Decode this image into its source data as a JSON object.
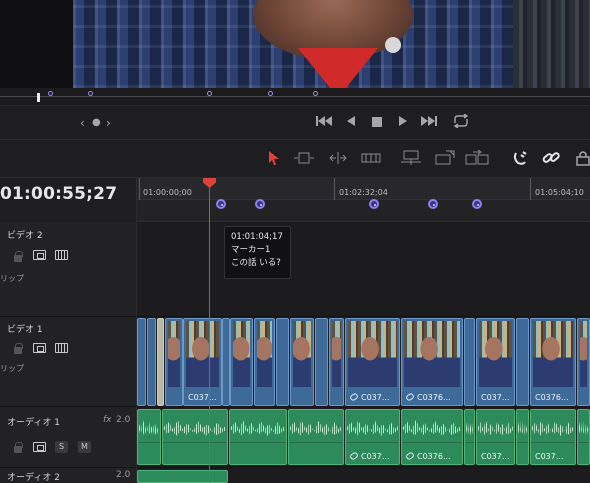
{
  "viewer": {
    "jog_markers": 5
  },
  "ruler": {
    "timecode": "01:00:55;27",
    "ticks": [
      "01:00:00;00",
      "01:02:32;04",
      "01:05:04;10"
    ]
  },
  "tooltip": {
    "timecode": "01:01:04;17",
    "name": "マーカー1",
    "note": "この話 いる?"
  },
  "tracks": {
    "video2": {
      "label": "ビデオ 2",
      "sub": "リップ"
    },
    "video1": {
      "label": "ビデオ 1",
      "sub": "リップ"
    },
    "audio1": {
      "label": "オーディオ 1",
      "fx": "fx",
      "level": "2.0",
      "solo": "S",
      "mute": "M"
    },
    "audio2": {
      "label": "オーディオ 2",
      "level": "2.0"
    }
  },
  "video_clips": {
    "c1": "C037...",
    "c2": "C037...",
    "c3": "C0376...",
    "c4": "C037...",
    "c5": "C0376...",
    "c6": "C037...",
    "c7": "C037..."
  },
  "audio_clips": {
    "c1": "C037...",
    "c2": "C0376...",
    "c3": "C037...",
    "c4": "C037..."
  },
  "colors": {
    "playhead": "#e0413a",
    "marker": "#8d82f0",
    "video_clip": "#3e6a9a",
    "audio_clip": "#2d8a5a"
  }
}
